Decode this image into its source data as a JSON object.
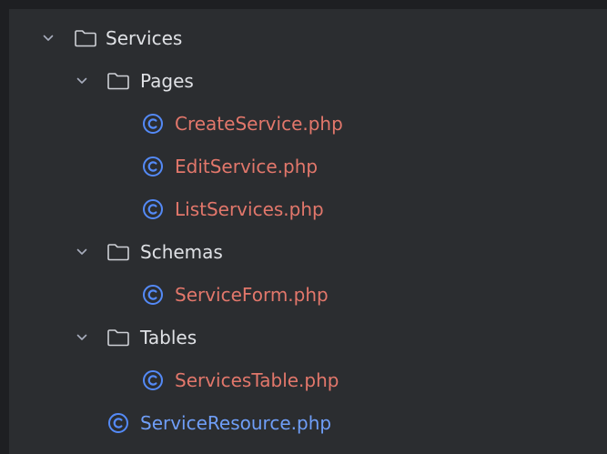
{
  "tree": {
    "items": [
      {
        "label": "Services",
        "type": "folder",
        "depth": 0,
        "expanded": true
      },
      {
        "label": "Pages",
        "type": "folder",
        "depth": 1,
        "expanded": true
      },
      {
        "label": "CreateService.php",
        "type": "class-file",
        "depth": 2,
        "status": "modified"
      },
      {
        "label": "EditService.php",
        "type": "class-file",
        "depth": 2,
        "status": "modified"
      },
      {
        "label": "ListServices.php",
        "type": "class-file",
        "depth": 2,
        "status": "modified"
      },
      {
        "label": "Schemas",
        "type": "folder",
        "depth": 1,
        "expanded": true
      },
      {
        "label": "ServiceForm.php",
        "type": "class-file",
        "depth": 2,
        "status": "modified"
      },
      {
        "label": "Tables",
        "type": "folder",
        "depth": 1,
        "expanded": true
      },
      {
        "label": "ServicesTable.php",
        "type": "class-file",
        "depth": 2,
        "status": "modified"
      },
      {
        "label": "ServiceResource.php",
        "type": "class-file",
        "depth": 1,
        "status": "changed"
      }
    ]
  },
  "colors": {
    "background": "#2b2d30",
    "outer": "#1e1f22",
    "folder_text": "#dfe1e5",
    "modified_file_text": "#e2776b",
    "changed_file_text": "#6f9ef8",
    "class_icon": "#548af7",
    "chevron": "#a8adbd"
  },
  "icons": {
    "expanded": "chevron-down-icon",
    "folder": "folder-icon",
    "class_file": "class-file-icon"
  }
}
